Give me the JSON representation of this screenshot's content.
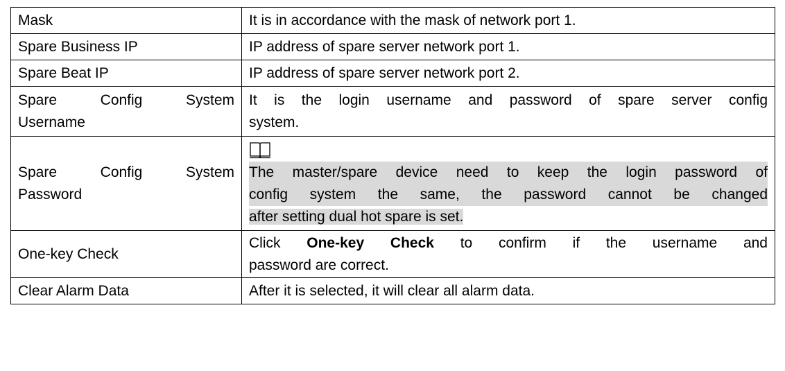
{
  "rows": [
    {
      "param": "Mask",
      "desc": "It is in accordance with the mask of network port 1."
    },
    {
      "param": "Spare Business IP",
      "desc": "IP address of spare server network port 1."
    },
    {
      "param": "Spare Beat IP",
      "desc": "IP address of spare server network port 2."
    },
    {
      "param_line1": "Spare Config System",
      "param_line2": "Username",
      "desc_line1": "It is the login username and password of spare server config",
      "desc_line2": "system."
    },
    {
      "param_line1": "Spare Config System",
      "param_line2": "Password",
      "note_icon": "book-note-icon",
      "note_line1": "The master/spare device need to keep the login password of",
      "note_line2": "config system the same, the password cannot be changed",
      "note_line3": "after setting dual hot spare is set."
    },
    {
      "param": "One-key Check",
      "desc_pre": "Click ",
      "desc_bold": "One-key Check",
      "desc_post": " to confirm if the username and",
      "desc_line2": "password are correct."
    },
    {
      "param": "Clear Alarm Data",
      "desc": "After it is selected, it will clear all alarm data."
    }
  ]
}
